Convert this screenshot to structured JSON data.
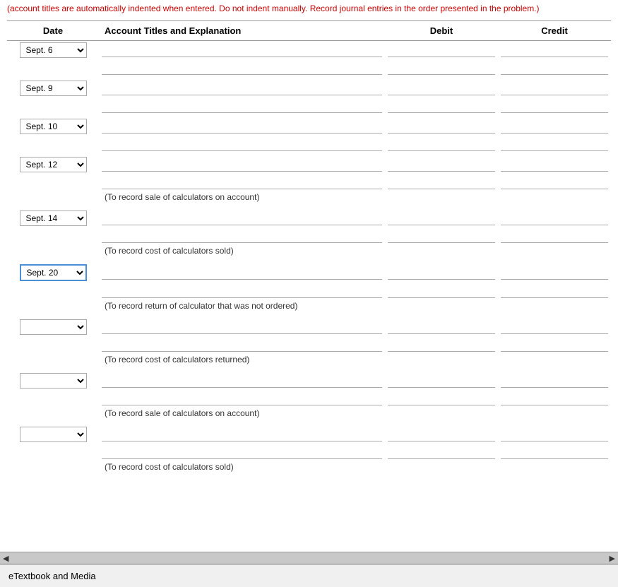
{
  "top_notice": "(account titles are automatically indented when entered. Do not indent manually. Record journal entries in the order presented in the problem.)",
  "table": {
    "headers": {
      "date": "Date",
      "account": "Account Titles and Explanation",
      "debit": "Debit",
      "credit": "Credit"
    },
    "entries": [
      {
        "id": "entry1",
        "date_value": "Sept. 6",
        "rows": 2,
        "explanation": null
      },
      {
        "id": "entry2",
        "date_value": "Sept. 9",
        "rows": 2,
        "explanation": null
      },
      {
        "id": "entry3",
        "date_value": "Sept. 10",
        "rows": 2,
        "explanation": null
      },
      {
        "id": "entry4",
        "date_value": "Sept. 12",
        "rows": 2,
        "explanation": "(To record sale of calculators on account)"
      },
      {
        "id": "entry5",
        "date_value": "Sept. 14",
        "rows": 2,
        "explanation": "(To record cost of calculators sold)"
      },
      {
        "id": "entry6",
        "date_value": "Sept. 20",
        "rows": 2,
        "explanation": "(To record return of calculator that was not ordered)",
        "highlighted": true
      },
      {
        "id": "entry7",
        "date_value": "",
        "rows": 2,
        "explanation": "(To record cost of calculators returned)"
      },
      {
        "id": "entry8",
        "date_value": "",
        "rows": 2,
        "explanation": "(To record sale of calculators on account)"
      },
      {
        "id": "entry9",
        "date_value": "",
        "rows": 2,
        "explanation": "(To record cost of calculators sold)"
      }
    ],
    "date_options": [
      "",
      "Sept. 6",
      "Sept. 9",
      "Sept. 10",
      "Sept. 12",
      "Sept. 14",
      "Sept. 20"
    ]
  },
  "footer": {
    "label": "eTextbook and Media"
  },
  "scrollbar": {
    "left_arrow": "◀",
    "right_arrow": "▶"
  }
}
